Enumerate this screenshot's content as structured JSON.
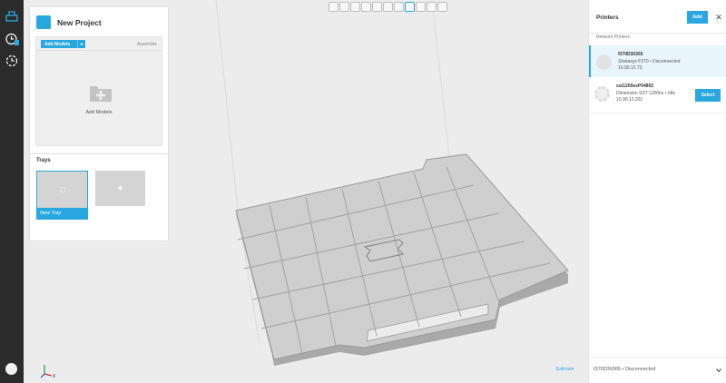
{
  "app": {
    "accent_color": "#29a8e0",
    "rail_icons": [
      "printer-icon",
      "job-queue-icon",
      "history-icon"
    ]
  },
  "project": {
    "title": "New Project",
    "add_models_label": "Add Models",
    "assemble_label": "Assemble",
    "empty_hint": "Add Models",
    "trays_heading": "Trays",
    "trays": [
      {
        "name": "New Tray",
        "selected": true
      }
    ]
  },
  "printers": {
    "title": "Printers",
    "add_label": "Add",
    "section_label": "Network Printers",
    "items": [
      {
        "name": "f370D30365",
        "model_status": "Stratasys F370 • Disconnected",
        "ip": "10.90.12.73",
        "selected": true
      },
      {
        "name": "sst1200esP04802",
        "model_status": "Dimension SST 1200es • Idle",
        "ip": "10.90.12.201",
        "select_label": "Select"
      }
    ],
    "footer_status": "f370D30365 • Disconnected"
  },
  "viewport": {
    "estimate_label": "Estimate",
    "axes": {
      "x": "X",
      "y": "Y",
      "z": "Z"
    }
  }
}
